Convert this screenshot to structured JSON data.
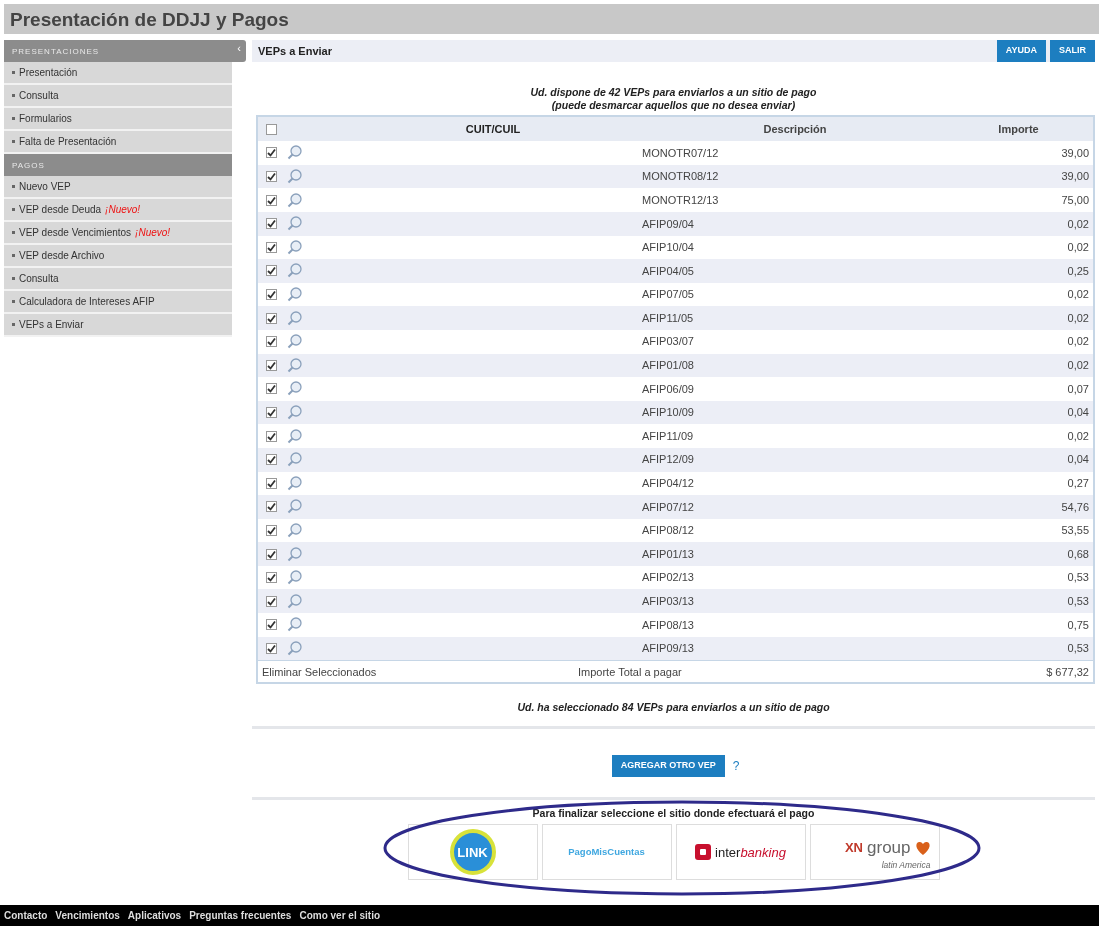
{
  "window": {
    "title": "Presentación de DDJJ y Pagos"
  },
  "sidebar": {
    "sections": [
      {
        "heading": "PRESENTACIONES",
        "items": [
          {
            "label": "Presentación"
          },
          {
            "label": "Consulta"
          },
          {
            "label": "Formularios"
          },
          {
            "label": "Falta de Presentación"
          }
        ]
      },
      {
        "heading": "PAGOS",
        "items": [
          {
            "label": "Nuevo VEP"
          },
          {
            "label": "VEP desde Deuda",
            "badge": "¡Nuevo!"
          },
          {
            "label": "VEP desde Vencimientos",
            "badge": "¡Nuevo!"
          },
          {
            "label": "VEP desde Archivo"
          },
          {
            "label": "Consulta"
          },
          {
            "label": "Calculadora de Intereses AFIP"
          },
          {
            "label": "VEPs a Enviar"
          }
        ]
      }
    ]
  },
  "collapse_handle": "‹",
  "panel": {
    "title": "VEPs a Enviar",
    "buttons": [
      "AYUDA",
      "SALIR"
    ]
  },
  "intro": [
    "Ud. dispone de 42 VEPs para enviarlos a un sitio de pago",
    "(puede desmarcar aquellos que no desea enviar)"
  ],
  "table": {
    "select_all_checked": false,
    "columns": [
      "CUIT/CUIL",
      "Descripción",
      "Importe"
    ],
    "rows": [
      {
        "checked": true,
        "description": "MONOTR07/12",
        "amount": "39,00"
      },
      {
        "checked": true,
        "description": "MONOTR08/12",
        "amount": "39,00"
      },
      {
        "checked": true,
        "description": "MONOTR12/13",
        "amount": "75,00"
      },
      {
        "checked": true,
        "description": "AFIP09/04",
        "amount": "0,02"
      },
      {
        "checked": true,
        "description": "AFIP10/04",
        "amount": "0,02"
      },
      {
        "checked": true,
        "description": "AFIP04/05",
        "amount": "0,25"
      },
      {
        "checked": true,
        "description": "AFIP07/05",
        "amount": "0,02"
      },
      {
        "checked": true,
        "description": "AFIP11/05",
        "amount": "0,02"
      },
      {
        "checked": true,
        "description": "AFIP03/07",
        "amount": "0,02"
      },
      {
        "checked": true,
        "description": "AFIP01/08",
        "amount": "0,02"
      },
      {
        "checked": true,
        "description": "AFIP06/09",
        "amount": "0,07"
      },
      {
        "checked": true,
        "description": "AFIP10/09",
        "amount": "0,04"
      },
      {
        "checked": true,
        "description": "AFIP11/09",
        "amount": "0,02"
      },
      {
        "checked": true,
        "description": "AFIP12/09",
        "amount": "0,04"
      },
      {
        "checked": true,
        "description": "AFIP04/12",
        "amount": "0,27"
      },
      {
        "checked": true,
        "description": "AFIP07/12",
        "amount": "54,76"
      },
      {
        "checked": true,
        "description": "AFIP08/12",
        "amount": "53,55"
      },
      {
        "checked": true,
        "description": "AFIP01/13",
        "amount": "0,68"
      },
      {
        "checked": true,
        "description": "AFIP02/13",
        "amount": "0,53"
      },
      {
        "checked": true,
        "description": "AFIP03/13",
        "amount": "0,53"
      },
      {
        "checked": true,
        "description": "AFIP08/13",
        "amount": "0,75"
      },
      {
        "checked": true,
        "description": "AFIP09/13",
        "amount": "0,53"
      }
    ],
    "footer": {
      "delete_link": "Eliminar Seleccionados",
      "total_label": "Importe Total a pagar",
      "total": "$ 677,32"
    }
  },
  "selected_message": "Ud. ha seleccionado 84 VEPs para enviarlos a un sitio de pago",
  "add_button": "AGREGAR OTRO VEP",
  "help_mark": "?",
  "payment": {
    "prompt": "Para finalizar seleccione el sitio donde efectuará el pago",
    "sites": [
      {
        "kind": "link",
        "name": "LINK"
      },
      {
        "kind": "pmc",
        "name": "PagoMisCuentas"
      },
      {
        "kind": "interbanking",
        "name": "inter",
        "name2": "banking"
      },
      {
        "kind": "xn",
        "name": "XN",
        "name2": "group",
        "sub": "latin America"
      }
    ]
  },
  "footer_links": [
    "Contacto",
    "Vencimientos",
    "Aplicativos",
    "Preguntas frecuentes",
    "Como ver el sitio"
  ]
}
